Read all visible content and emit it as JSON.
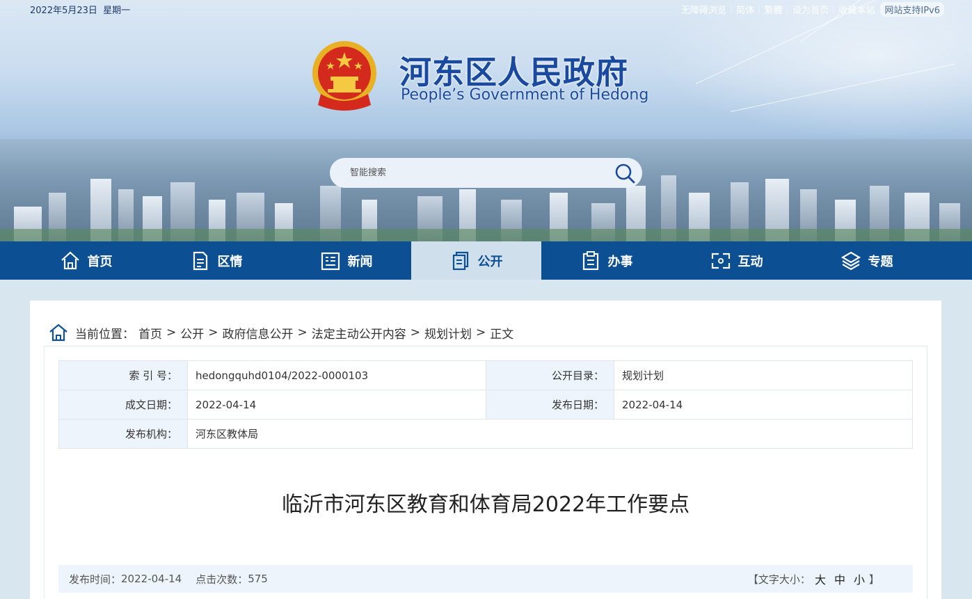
{
  "header": {
    "date": "2022年5月23日",
    "weekday": "星期一",
    "toplinks": [
      "无障碍浏览",
      "简体",
      "繁體",
      "设为首页",
      "收藏本站"
    ],
    "ipv6": "网站支持IPv6",
    "site_name_cn": "河东区人民政府",
    "site_name_en": "People’s Government of Hedong",
    "search_placeholder": "智能搜索"
  },
  "nav": {
    "items": [
      {
        "label": "首页",
        "icon": "home-icon"
      },
      {
        "label": "区情",
        "icon": "document-icon"
      },
      {
        "label": "新闻",
        "icon": "news-icon"
      },
      {
        "label": "公开",
        "icon": "copy-icon",
        "active": true
      },
      {
        "label": "办事",
        "icon": "clipboard-icon"
      },
      {
        "label": "互动",
        "icon": "interact-icon"
      },
      {
        "label": "专题",
        "icon": "layers-icon"
      }
    ]
  },
  "breadcrumb": {
    "prefix": "当前位置：",
    "items": [
      "首页",
      "公开",
      "政府信息公开",
      "法定主动公开内容",
      "规划计划",
      "正文"
    ]
  },
  "meta": {
    "index_label": "索 引 号：",
    "index_value": "hedongquhd0104/2022-0000103",
    "catalog_label": "公开目录：",
    "catalog_value": "规划计划",
    "written_label": "成文日期：",
    "written_value": "2022-04-14",
    "published_label": "发布日期：",
    "published_value": "2022-04-14",
    "org_label": "发布机构：",
    "org_value": "河东区教体局"
  },
  "article": {
    "title": "临沂市河东区教育和体育局2022年工作要点",
    "publish_time_label": "发布时间：",
    "publish_time": "2022-04-14",
    "hits_label": "点击次数：",
    "hits": "575",
    "font_size_label": "【文字大小：",
    "font_large": "大",
    "font_medium": "中",
    "font_small": "小",
    "font_size_close": "】"
  },
  "colors": {
    "nav_bg": "#0d4f93",
    "nav_active_bg": "#cfe0ec",
    "title_blue": "#1a4aa0"
  }
}
